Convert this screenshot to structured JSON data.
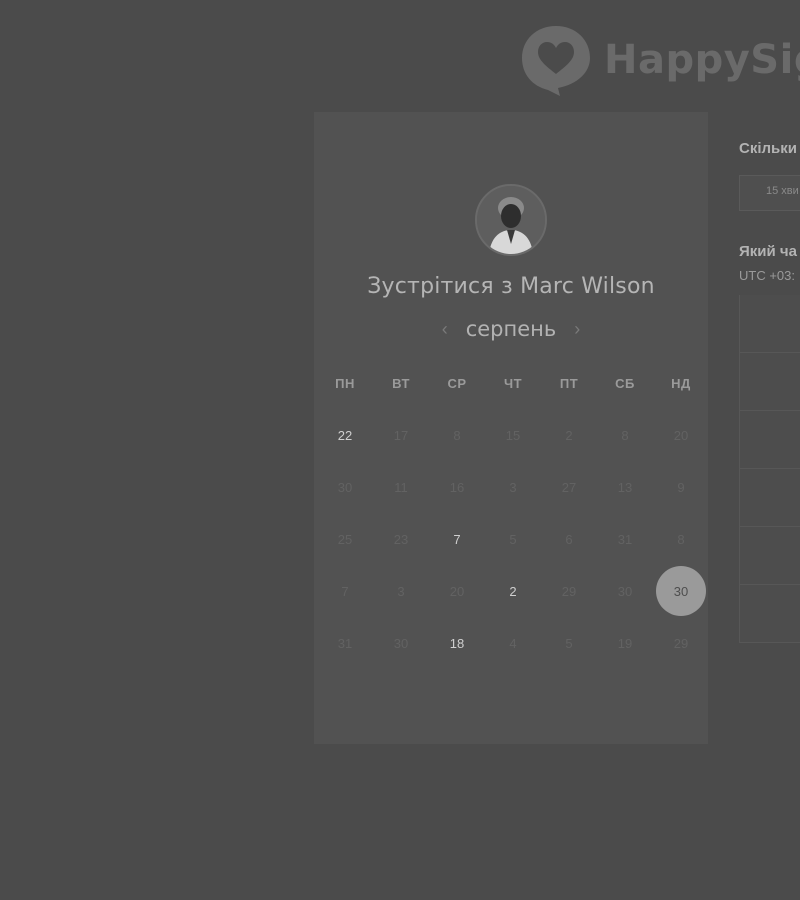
{
  "brand": {
    "name": "HappySig"
  },
  "meeting": {
    "title": "Зустрітися з Marc Wilson",
    "month": "серпень",
    "prev_icon": "‹",
    "next_icon": "›"
  },
  "calendar": {
    "weekdays": [
      "ПН",
      "ВТ",
      "СР",
      "ЧТ",
      "ПТ",
      "СБ",
      "НД"
    ],
    "weeks": [
      [
        "22",
        "17",
        "8",
        "15",
        "2",
        "8",
        "20"
      ],
      [
        "30",
        "11",
        "16",
        "3",
        "27",
        "13",
        "9"
      ],
      [
        "25",
        "23",
        "7",
        "5",
        "6",
        "31",
        "8"
      ],
      [
        "7",
        "3",
        "20",
        "2",
        "29",
        "30",
        "30"
      ],
      [
        "31",
        "30",
        "18",
        "4",
        "5",
        "19",
        "29"
      ]
    ],
    "selected_day": "30"
  },
  "right_panel": {
    "duration_question": "Скільки",
    "duration_value": "15 хви",
    "time_question": "Який ча",
    "timezone": "UTC +03:"
  }
}
